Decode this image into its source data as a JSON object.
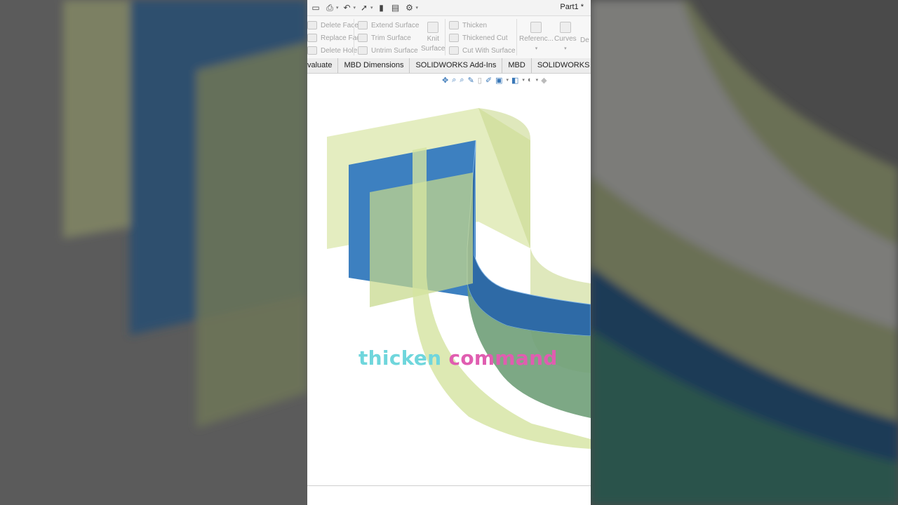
{
  "app": {
    "document_title": "Part1 *"
  },
  "quick_access": {
    "icons": [
      "new-icon",
      "print-icon",
      "undo-icon",
      "select-icon",
      "rebuild-icon",
      "file-properties-icon",
      "options-icon"
    ]
  },
  "ribbon": {
    "group_faces": [
      "Delete Face",
      "Replace Face",
      "Delete Hole"
    ],
    "group_surface": [
      "Extend Surface",
      "Trim Surface",
      "Untrim Surface"
    ],
    "knit_label_line1": "Knit",
    "knit_label_line2": "Surface",
    "group_thicken": [
      "Thicken",
      "Thickened Cut",
      "Cut With Surface"
    ],
    "reference_label": "Referenc...",
    "curves_label": "Curves",
    "cut_off_label": "De"
  },
  "tabs": [
    "valuate",
    "MBD Dimensions",
    "SOLIDWORKS Add-Ins",
    "MBD",
    "SOLIDWORKS Visualiz"
  ],
  "heads_up_icons": [
    "zoom-to-fit-icon",
    "zoom-area-icon",
    "previous-view-icon",
    "section-view-icon",
    "dynamic-annotation-icon",
    "view-orientation-icon",
    "display-style-icon",
    "hide-show-icon",
    "appearance-icon",
    "scene-icon"
  ],
  "caption": {
    "word1": "thicken",
    "word2": "command",
    "color1": "#6fd6dc",
    "color2": "#e05db0"
  },
  "colors": {
    "surface_yellow": "#d9e6a8",
    "surface_blue": "#3d80c0",
    "surface_green": "#6f9e78"
  }
}
